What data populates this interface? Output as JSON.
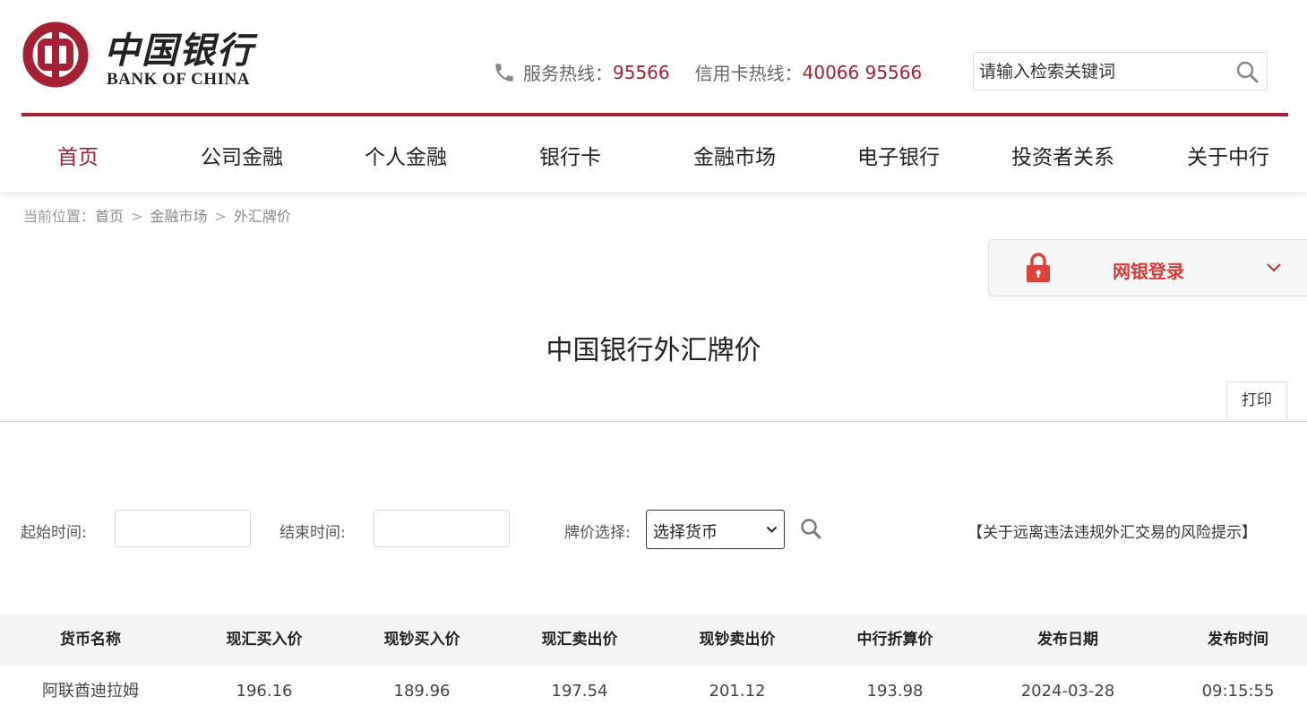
{
  "header": {
    "logo_cn": "中国银行",
    "logo_en": "BANK OF CHINA",
    "service_label": "服务热线：",
    "service_number": "95566",
    "card_label": "信用卡热线：",
    "card_number": "40066 95566",
    "search_placeholder": "请输入检索关键词"
  },
  "colors": {
    "brand": "#a62035",
    "login": "#d63a3a"
  },
  "nav": {
    "items": [
      {
        "label": "首页",
        "active": true
      },
      {
        "label": "公司金融"
      },
      {
        "label": "个人金融"
      },
      {
        "label": "银行卡"
      },
      {
        "label": "金融市场"
      },
      {
        "label": "电子银行"
      },
      {
        "label": "投资者关系"
      },
      {
        "label": "关于中行"
      }
    ]
  },
  "breadcrumb": {
    "prefix": "当前位置：",
    "items": [
      "首页",
      "金融市场",
      "外汇牌价"
    ],
    "separator": ">"
  },
  "login": {
    "label": "网银登录"
  },
  "page": {
    "title": "中国银行外汇牌价",
    "print_label": "打印"
  },
  "filter": {
    "start_label": "起始时间:",
    "start_value": "",
    "end_label": "结束时间:",
    "end_value": "",
    "currency_label": "牌价选择:",
    "currency_selected": "选择货币",
    "risk_link": "【关于远离违法违规外汇交易的风险提示】"
  },
  "table": {
    "headers": [
      "货币名称",
      "现汇买入价",
      "现钞买入价",
      "现汇卖出价",
      "现钞卖出价",
      "中行折算价",
      "发布日期",
      "发布时间"
    ],
    "rows": [
      [
        "阿联酋迪拉姆",
        "196.16",
        "189.96",
        "197.54",
        "201.12",
        "193.98",
        "2024-03-28",
        "09:15:55"
      ]
    ]
  }
}
